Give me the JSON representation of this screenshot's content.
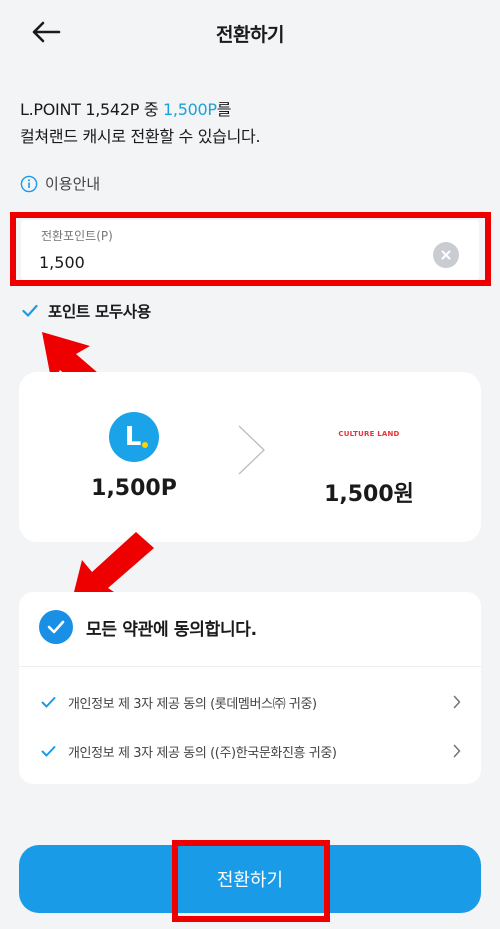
{
  "header": {
    "title": "전환하기",
    "back_icon": "arrow-left-icon"
  },
  "intro": {
    "line1_prefix": "L.POINT 1,542P 중 ",
    "line1_accent": "1,500P",
    "line1_suffix": "를",
    "line2": "컬쳐랜드 캐시로 전환할 수 있습니다."
  },
  "guide": {
    "label": "이용안내",
    "icon": "info-icon"
  },
  "field": {
    "label": "전환포인트(P)",
    "value": "1,500",
    "clear_icon": "clear-icon"
  },
  "use_all": {
    "label": "포인트 모두사용",
    "checked": true
  },
  "conversion": {
    "from_logo": "L",
    "to_logo": "CULTURE LAND",
    "from_amount": "1,500P",
    "to_amount": "1,500원"
  },
  "terms": {
    "all_label": "모든 약관에 동의합니다.",
    "items": [
      {
        "label": "개인정보 제 3자 제공 동의 (롯데멤버스㈜ 귀중)"
      },
      {
        "label": "개인정보 제 3자 제공 동의 ((주)한국문화진흥 귀중)"
      }
    ]
  },
  "submit": {
    "label": "전환하기"
  },
  "colors": {
    "accent": "#1a9be8",
    "highlight": "#ee0000",
    "background": "#f3f4f6"
  }
}
